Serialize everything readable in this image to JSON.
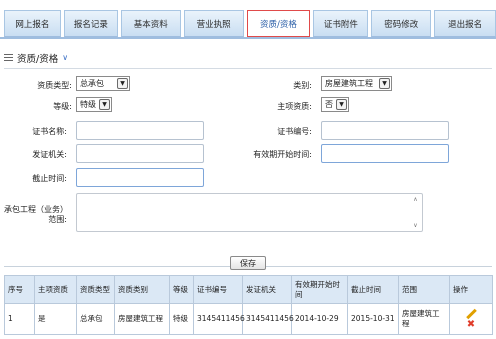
{
  "nav": {
    "tabs": [
      {
        "label": "网上报名"
      },
      {
        "label": "报名记录"
      },
      {
        "label": "基本资料"
      },
      {
        "label": "营业执照"
      },
      {
        "label": "资质/资格",
        "active": true
      },
      {
        "label": "证书附件"
      },
      {
        "label": "密码修改"
      },
      {
        "label": "退出报名"
      }
    ]
  },
  "section": {
    "title": "资质/资格"
  },
  "form": {
    "qual_type_label": "资质类型:",
    "qual_type_value": "总承包",
    "category_label": "类别:",
    "category_value": "房屋建筑工程",
    "grade_label": "等级:",
    "grade_value": "特级",
    "main_qual_label": "主项资质:",
    "main_qual_value": "否",
    "cert_name_label": "证书名称:",
    "cert_no_label": "证书编号:",
    "issuer_label": "发证机关:",
    "valid_start_label": "有效期开始时间:",
    "deadline_label": "截止时间:",
    "scope_label_1": "承包工程（业务）",
    "scope_label_2": "范围:",
    "save_label": "保存"
  },
  "table": {
    "headers": [
      "序号",
      "主项资质",
      "资质类型",
      "资质类别",
      "等级",
      "证书编号",
      "发证机关",
      "有效期开始时间",
      "截止时间",
      "范围",
      "操作"
    ],
    "rows": [
      [
        "1",
        "是",
        "总承包",
        "房屋建筑工程",
        "特级",
        "3145411456",
        "3145411456",
        "2014-10-29",
        "2015-10-31",
        "房屋建筑工程"
      ]
    ]
  },
  "colors": {
    "tab_bg": "#c9def2",
    "active_tab_border": "#e04a4a",
    "header_bg": "#dbe8f5",
    "edit_icon": "#e0a000",
    "delete_icon": "#e03c2a"
  }
}
